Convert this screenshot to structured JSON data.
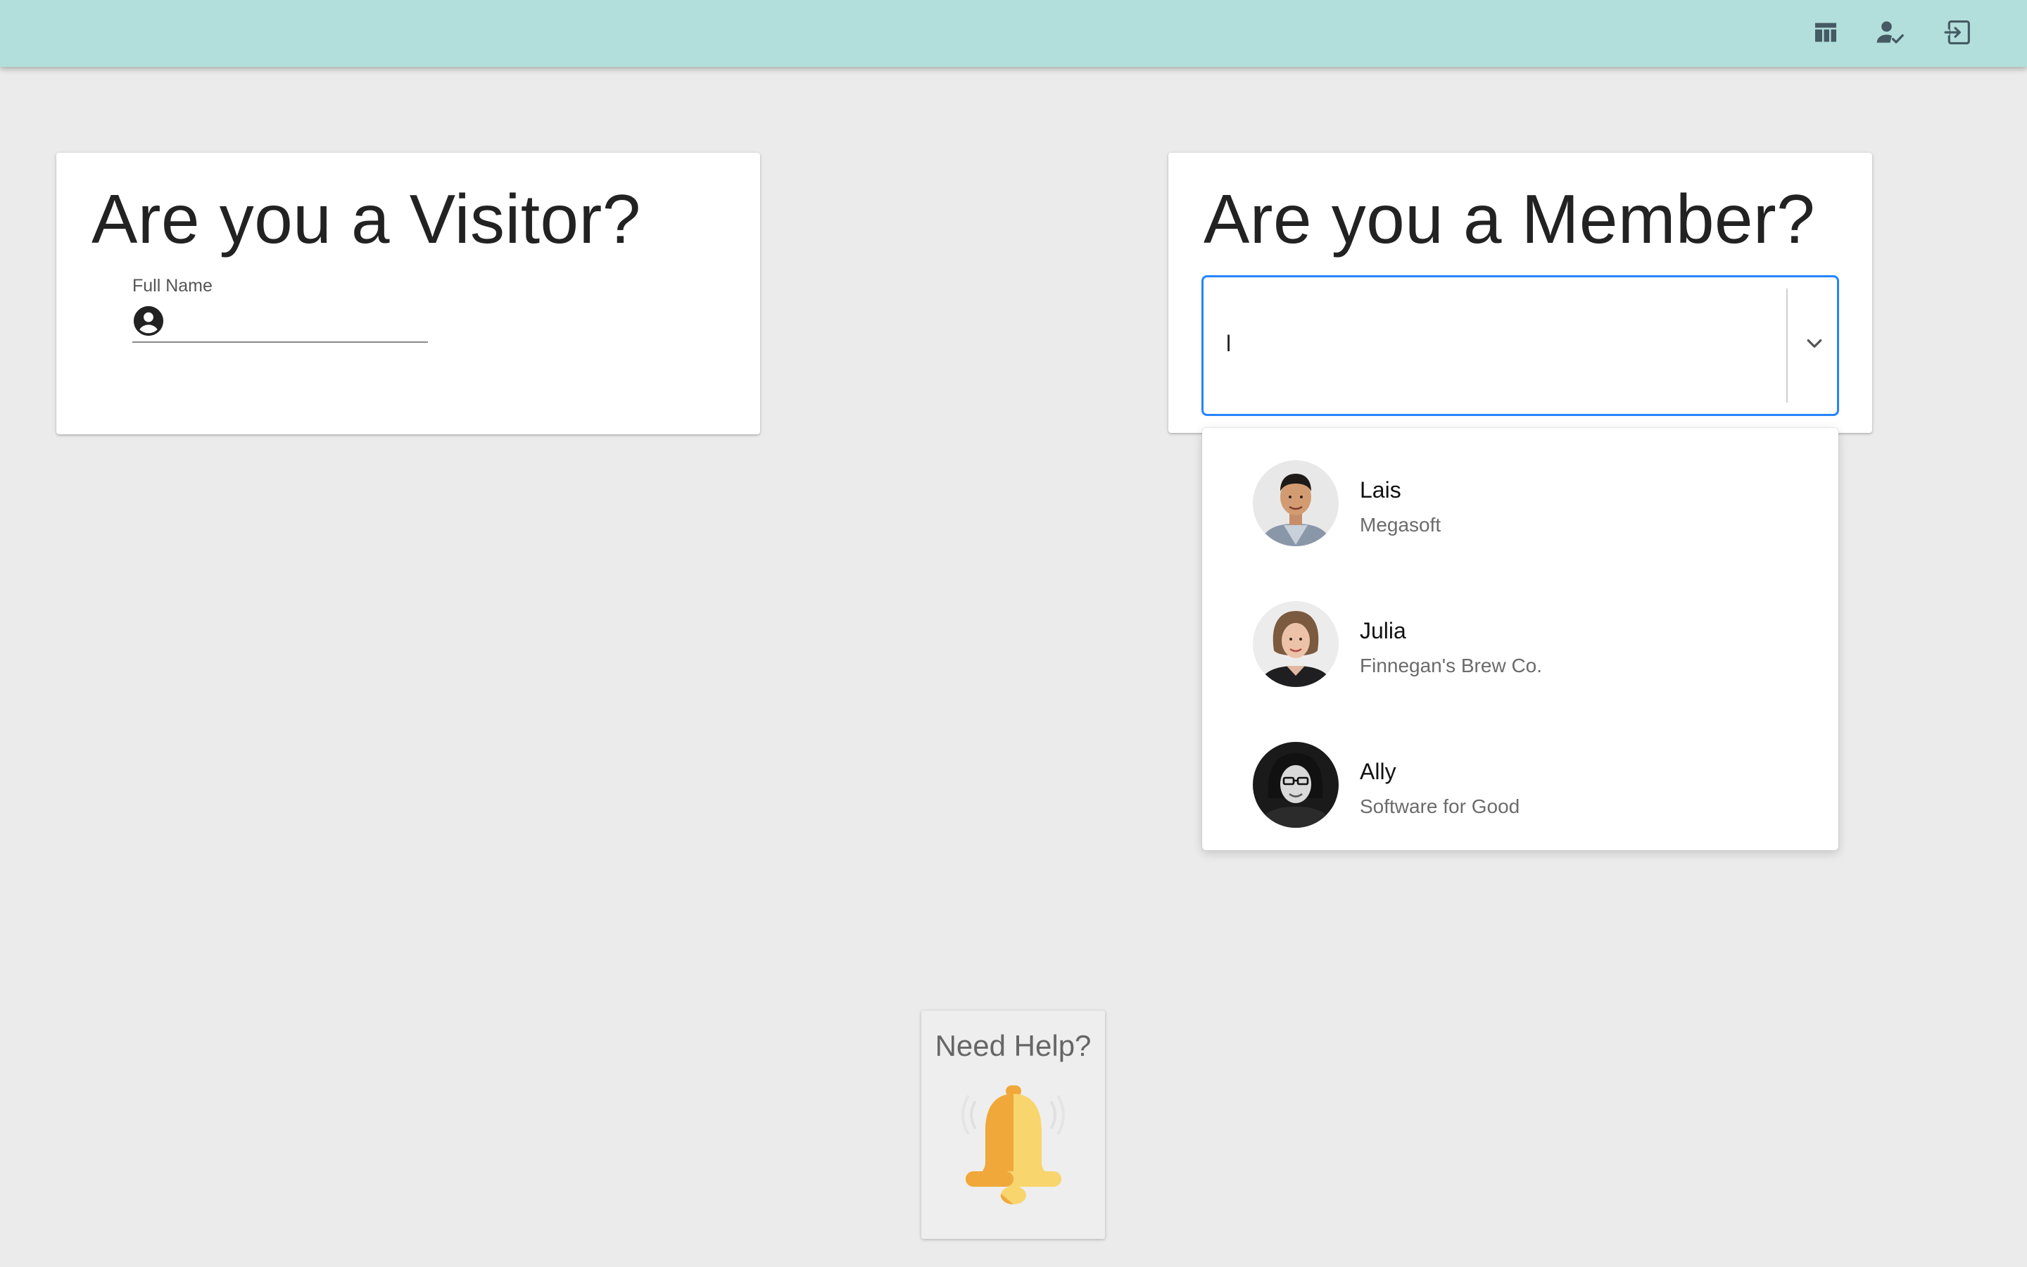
{
  "topbar": {
    "background_color": "#b2dfdb",
    "buttons": [
      {
        "icon": "dashboard-icon"
      },
      {
        "icon": "person-check-icon"
      },
      {
        "icon": "exit-icon"
      }
    ]
  },
  "visitor_card": {
    "title": "Are you a Visitor?",
    "full_name_label": "Full Name",
    "full_name_value": "",
    "full_name_icon": "account-circle-icon"
  },
  "member_card": {
    "title": "Are you a Member?",
    "select_value": "l",
    "select_icon": "chevron-down-icon",
    "focus_color": "#2684ff",
    "options": [
      {
        "name": "Lais",
        "company": "Megasoft",
        "avatar": "avatar-photo"
      },
      {
        "name": "Julia",
        "company": "Finnegan's Brew Co.",
        "avatar": "avatar-photo"
      },
      {
        "name": "Ally",
        "company": "Software for Good",
        "avatar": "avatar-photo"
      }
    ]
  },
  "help": {
    "label": "Need Help?",
    "icon": "bell-icon",
    "bell_colors": [
      "#f9d56e",
      "#f0a83a"
    ]
  }
}
